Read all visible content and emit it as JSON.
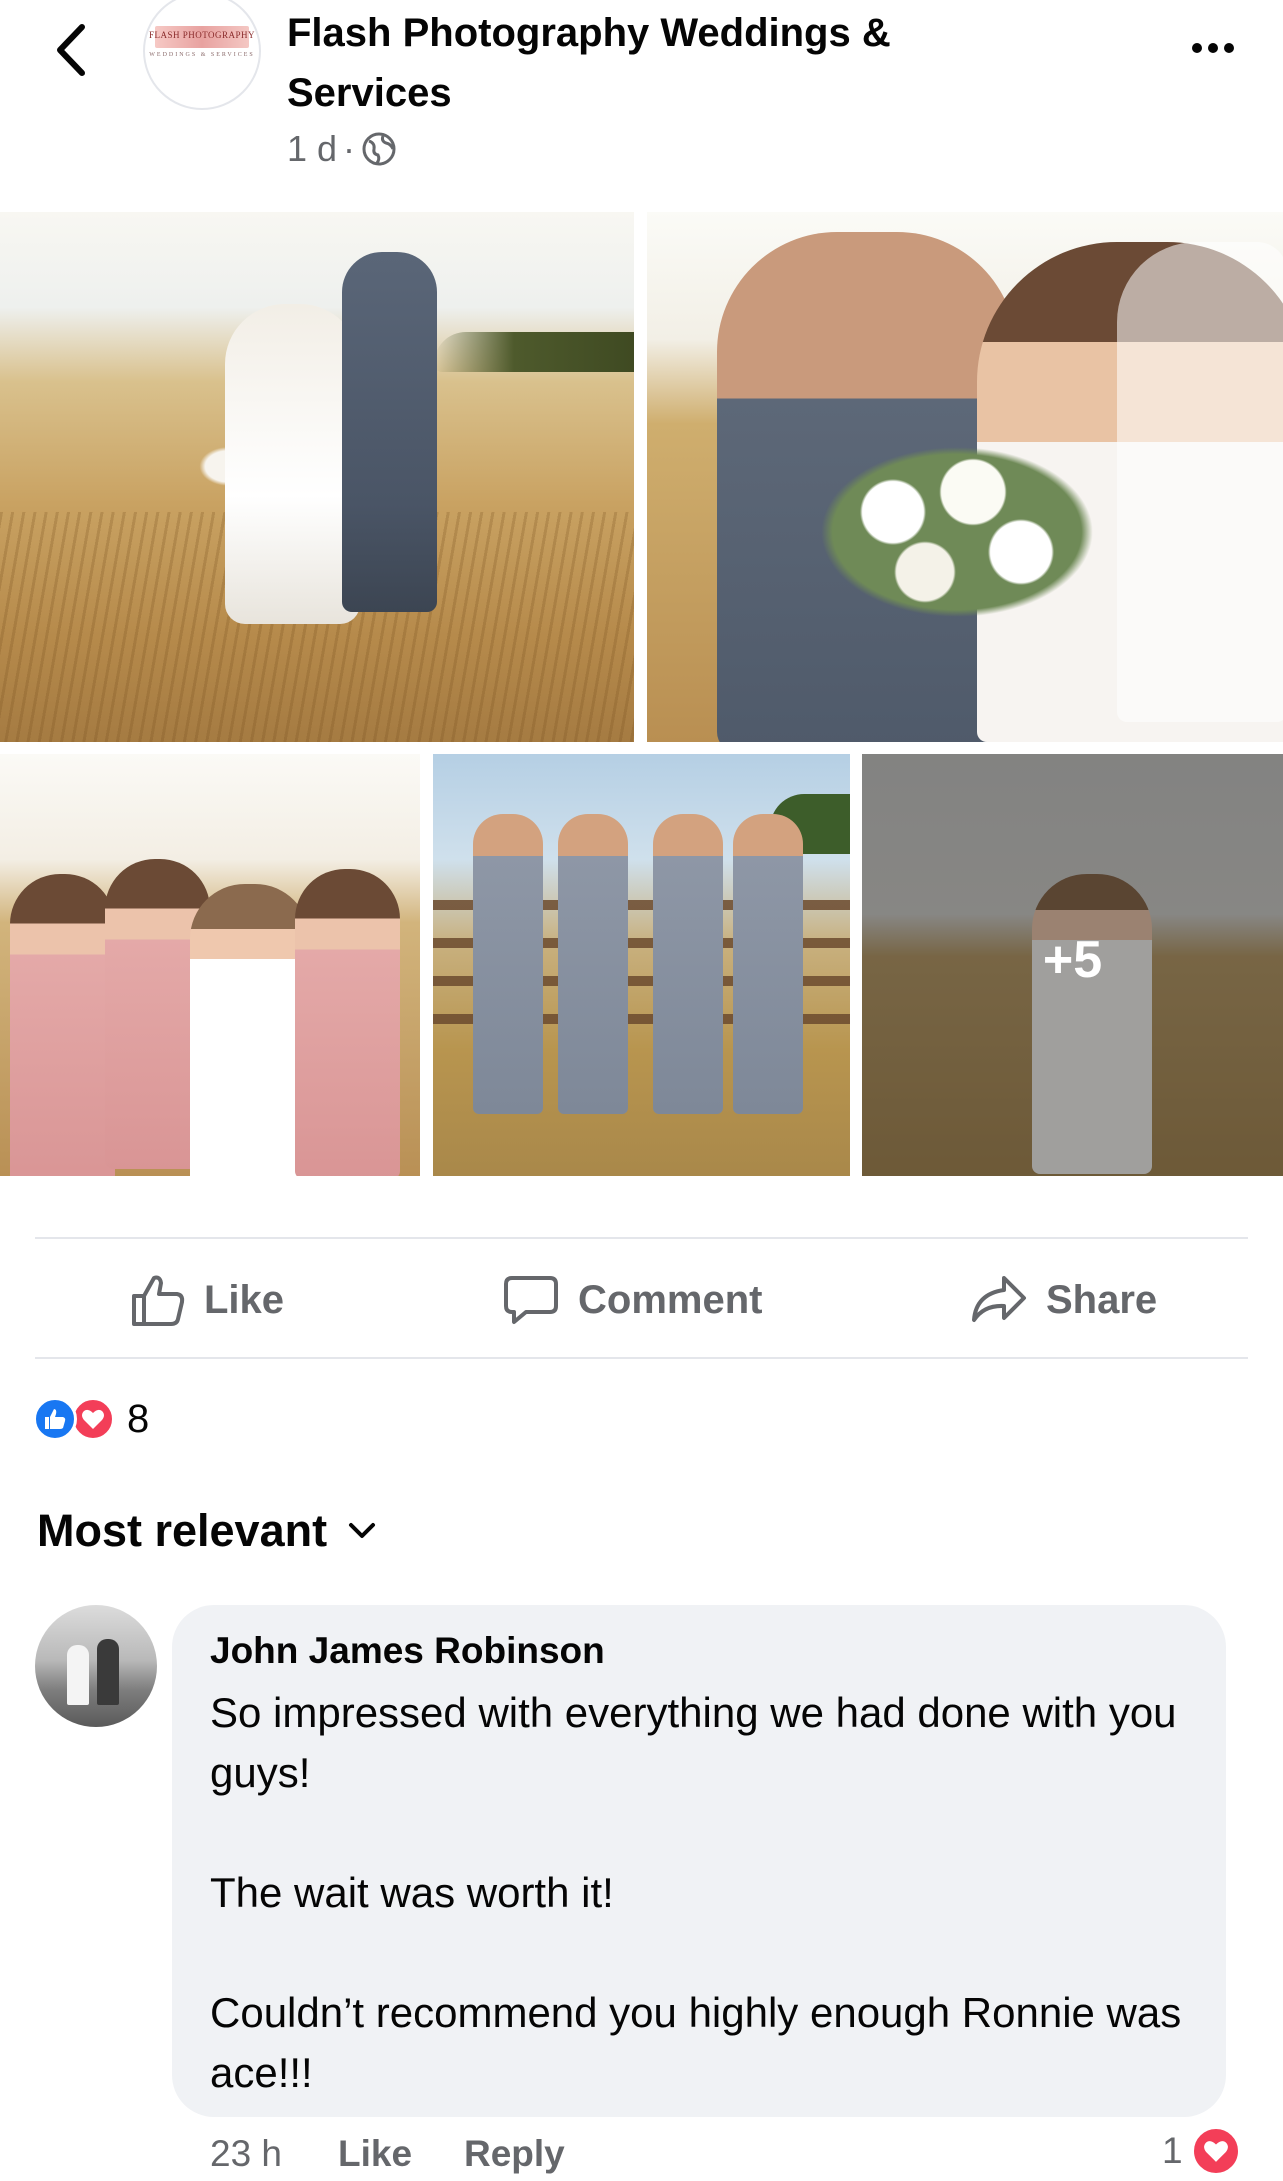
{
  "post": {
    "page_name": "Flash Photography Weddings & Services",
    "avatar_logo_text": "FLASH PHOTOGRAPHY",
    "avatar_logo_subtext": "WEDDINGS & SERVICES",
    "time": "1 d",
    "separator": "·",
    "audience_icon": "globe-icon",
    "more_photos_label": "+5"
  },
  "actions": {
    "like_label": "Like",
    "comment_label": "Comment",
    "share_label": "Share"
  },
  "reactions": {
    "types": [
      "like",
      "love"
    ],
    "count": "8"
  },
  "comments_section": {
    "sort_label": "Most relevant"
  },
  "comment": {
    "author": "John James Robinson",
    "text": "So impressed with everything we had done with you guys!\n\nThe wait was worth it!\n\nCouldn’t recommend you highly enough Ronnie was ace!!!",
    "time": "23 h",
    "like_label": "Like",
    "reply_label": "Reply",
    "reaction_count": "1",
    "reaction_type": "love"
  },
  "colors": {
    "like_blue": "#1877f2",
    "love_red": "#f33e58",
    "secondary_text": "#65676b",
    "bubble_bg": "#f0f2f5"
  }
}
